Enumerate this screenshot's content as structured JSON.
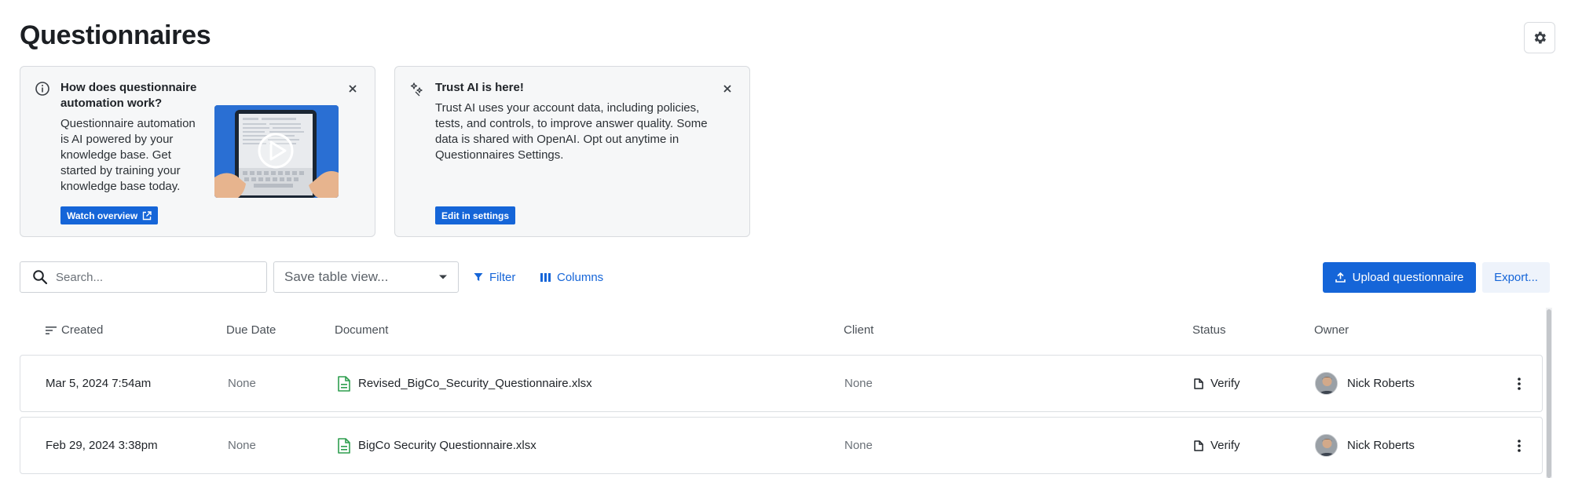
{
  "page": {
    "title": "Questionnaires"
  },
  "header": {
    "settings_icon": "gear-icon"
  },
  "cards": {
    "automation": {
      "title": "How does questionnaire automation work?",
      "body": "Questionnaire automation is AI powered by your knowledge base. Get started by training your knowledge base today.",
      "button_label": "Watch overview",
      "icons": {
        "info": "info-icon",
        "close": "close-icon",
        "external": "external-link-icon",
        "video": "play-icon"
      }
    },
    "trust_ai": {
      "title": "Trust AI is here!",
      "body": "Trust AI uses your account data, including policies, tests, and controls, to improve answer quality. Some data is shared with OpenAI. Opt out anytime in Questionnaires Settings.",
      "button_label": "Edit in settings",
      "icons": {
        "sparkle": "sparkle-icon",
        "close": "close-icon"
      }
    }
  },
  "toolbar": {
    "search_placeholder": "Search...",
    "search_value": "",
    "save_view_label": "Save table view...",
    "filter_label": "Filter",
    "columns_label": "Columns",
    "upload_label": "Upload questionnaire",
    "export_label": "Export..."
  },
  "table": {
    "columns": [
      "Created",
      "Due Date",
      "Document",
      "Client",
      "Status",
      "Owner"
    ],
    "rows": [
      {
        "created": "Mar 5, 2024 7:54am",
        "due_date": "None",
        "document": "Revised_BigCo_Security_Questionnaire.xlsx",
        "client": "None",
        "status": "Verify",
        "owner": "Nick Roberts"
      },
      {
        "created": "Feb 29, 2024 3:38pm",
        "due_date": "None",
        "document": "BigCo Security Questionnaire.xlsx",
        "client": "None",
        "status": "Verify",
        "owner": "Nick Roberts"
      }
    ]
  },
  "colors": {
    "accent": "#1565d8",
    "card_bg": "#f6f7f8",
    "file_icon": "#2e9e4f",
    "muted_text": "#6b7178"
  }
}
